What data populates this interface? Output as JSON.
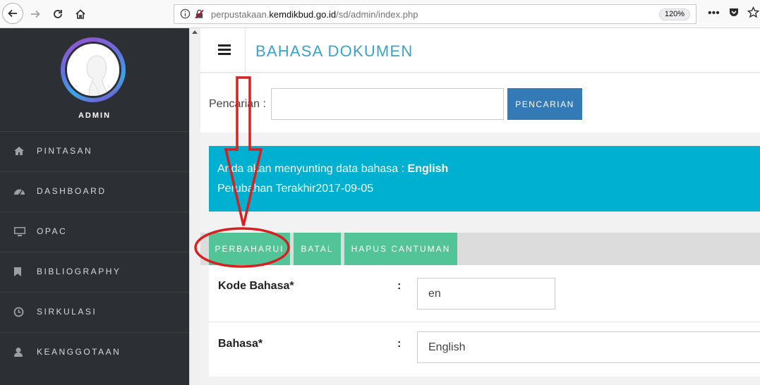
{
  "browser": {
    "url_prefix": "perpustakaan.",
    "url_domain": "kemdikbud.go.id",
    "url_path": "/sd/admin/index.php",
    "zoom": "120%"
  },
  "sidebar": {
    "user_label": "ADMIN",
    "items": [
      {
        "label": "PINTASAN",
        "icon": "home-icon"
      },
      {
        "label": "DASHBOARD",
        "icon": "dashboard-icon"
      },
      {
        "label": "OPAC",
        "icon": "monitor-icon"
      },
      {
        "label": "BIBLIOGRAPHY",
        "icon": "bookmark-icon"
      },
      {
        "label": "SIRKULASI",
        "icon": "clock-icon"
      },
      {
        "label": "KEANGGOTAAN",
        "icon": "user-icon"
      }
    ]
  },
  "header": {
    "title": "BAHASA DOKUMEN"
  },
  "search": {
    "label": "Pencarian :",
    "value": "",
    "button_label": "PENCARIAN"
  },
  "info": {
    "line1_prefix": "Anda akan menyunting data bahasa : ",
    "line1_value": "English",
    "line2": "Perubahan Terakhir2017-09-05"
  },
  "actions": {
    "update_label": "PERBAHARUI",
    "cancel_label": "BATAL",
    "delete_label": "HAPUS CANTUMAN"
  },
  "form": {
    "code_label": "Kode Bahasa*",
    "code_colon": ":",
    "code_value": "en",
    "lang_label": "Bahasa*",
    "lang_colon": ":",
    "lang_value": "English"
  },
  "colors": {
    "sidebar_bg": "#2c3034",
    "accent_title": "#3aa3c9",
    "info_bg": "#00b0d0",
    "button_green": "#52c497",
    "search_button": "#337ab7",
    "annotation_red": "#d92020"
  }
}
